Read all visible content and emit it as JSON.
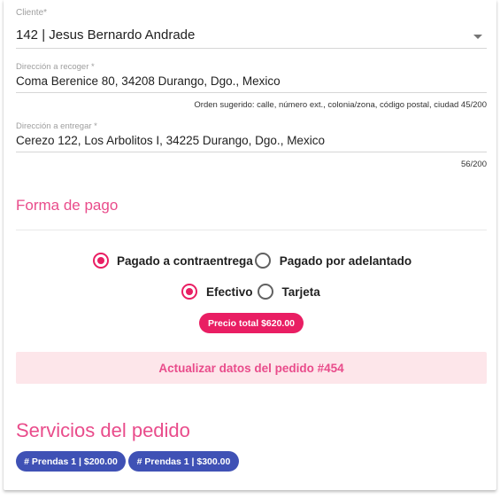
{
  "cliente": {
    "label": "Cliente*",
    "value": "142 | Jesus Bernardo Andrade"
  },
  "recoger": {
    "label": "Dirección a recoger *",
    "value": "Coma Berenice 80, 34208 Durango, Dgo., Mexico",
    "hint": "Orden sugerido: calle, número ext., colonia/zona, código postal, ciudad 45/200"
  },
  "entregar": {
    "label": "Dirección a entregar *",
    "value": "Cerezo 122, Los Arbolitos I, 34225 Durango, Dgo., Mexico",
    "counter": "56/200"
  },
  "pago": {
    "title": "Forma de pago",
    "momento": [
      {
        "label": "Pagado a contraentrega",
        "checked": true
      },
      {
        "label": "Pagado por adelantado",
        "checked": false
      }
    ],
    "metodo": [
      {
        "label": "Efectivo",
        "checked": true
      },
      {
        "label": "Tarjeta",
        "checked": false
      }
    ],
    "total": "Precio total $620.00"
  },
  "update_button": "Actualizar datos del pedido #454",
  "servicios": {
    "title": "Servicios del pedido",
    "chips": [
      "# Prendas 1 | $200.00",
      "# Prendas 1 | $300.00"
    ]
  },
  "colors": {
    "accent": "#e91e63",
    "chip": "#3f51b5",
    "button_bg": "#fde6ea",
    "title": "#e94c8b"
  }
}
